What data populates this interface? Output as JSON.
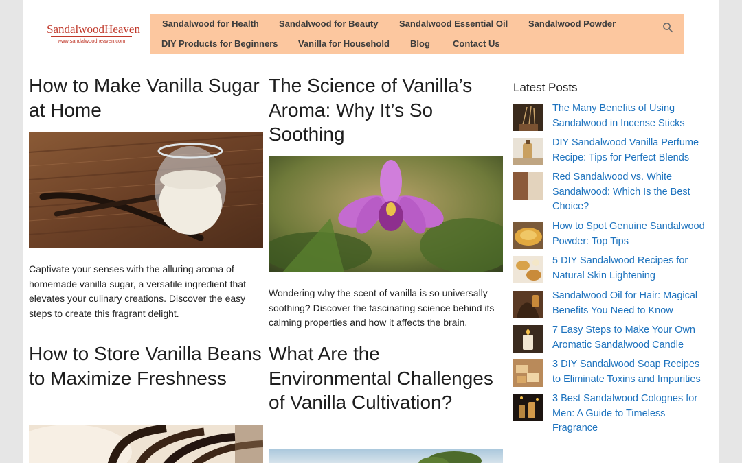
{
  "site": {
    "logo_text": "SandalwoodHeaven",
    "logo_url": "www.sandalwoodheaven.com"
  },
  "nav": {
    "items": [
      "Sandalwood for Health",
      "Sandalwood for Beauty",
      "Sandalwood Essential Oil",
      "Sandalwood Powder",
      "DIY Products for Beginners",
      "Vanilla for Household",
      "Blog",
      "Contact Us"
    ],
    "search_icon": "search-icon",
    "background_color": "#fcc79f"
  },
  "posts": [
    {
      "title": "How to Make Vanilla Sugar at Home",
      "excerpt": "Captivate your senses with the alluring aroma of homemade vanilla sugar, a versatile ingredient that elevates your culinary creations. Discover the easy steps to create this fragrant delight."
    },
    {
      "title": "The Science of Vanilla’s Aroma: Why It’s So Soothing",
      "excerpt": "Wondering why the scent of vanilla is so universally soothing? Discover the fascinating science behind its calming properties and how it affects the brain."
    },
    {
      "title": "How to Store Vanilla Beans to Maximize Freshness"
    },
    {
      "title": "What Are the Environmental Challenges of Vanilla Cultivation?"
    }
  ],
  "sidebar": {
    "heading": "Latest Posts",
    "latest_posts": [
      "The Many Benefits of Using Sandalwood in Incense Sticks",
      "DIY Sandalwood Vanilla Perfume Recipe: Tips for Perfect Blends",
      "Red Sandalwood vs. White Sandalwood: Which Is the Best Choice?",
      "How to Spot Genuine Sandalwood Powder: Top Tips",
      "5 DIY Sandalwood Recipes for Natural Skin Lightening",
      "Sandalwood Oil for Hair: Magical Benefits You Need to Know",
      "7 Easy Steps to Make Your Own Aromatic Sandalwood Candle",
      "3 DIY Sandalwood Soap Recipes to Eliminate Toxins and Impurities",
      "3 Best Sandalwood Colognes for Men: A Guide to Timeless Fragrance"
    ],
    "link_color": "#1e73be"
  }
}
